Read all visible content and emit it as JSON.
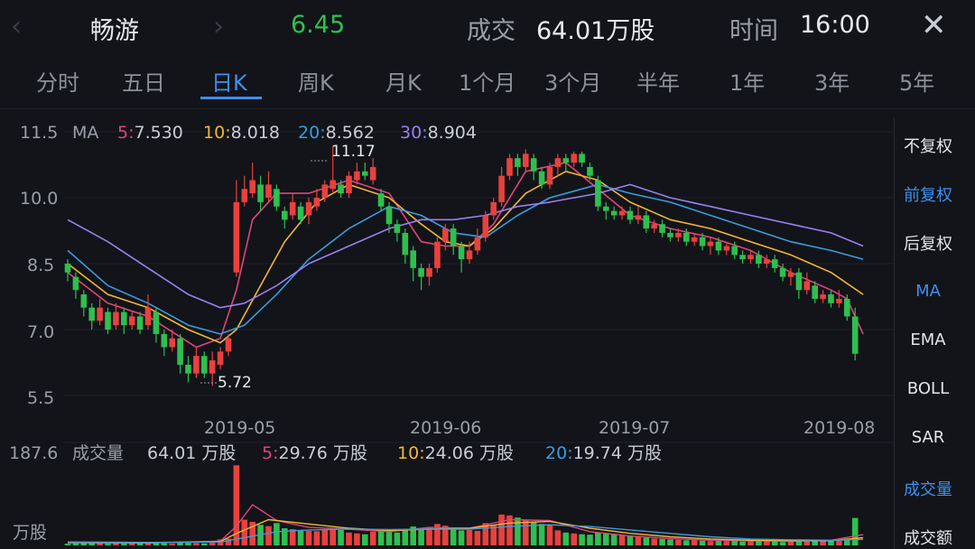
{
  "header": {
    "name": "畅游",
    "price": "6.45",
    "volume_label": "成交",
    "volume_value": "64.01万股",
    "time_label": "时间",
    "time_value": "16:00",
    "prev_icon": "chevron-left-icon",
    "next_icon": "chevron-right-icon",
    "close_icon": "close-icon"
  },
  "tabs": [
    "分时",
    "五日",
    "日K",
    "周K",
    "月K",
    "1个月",
    "3个月",
    "半年",
    "1年",
    "3年",
    "5年"
  ],
  "active_tab": "日K",
  "side_menu": [
    {
      "label": "不复权",
      "active": false
    },
    {
      "label": "前复权",
      "active": true
    },
    {
      "label": "后复权",
      "active": false
    },
    {
      "label": "MA",
      "active": true
    },
    {
      "label": "EMA",
      "active": false
    },
    {
      "label": "BOLL",
      "active": false
    },
    {
      "label": "SAR",
      "active": false
    },
    {
      "label": "成交量",
      "active": true
    },
    {
      "label": "成交额",
      "active": false
    }
  ],
  "colors": {
    "up": "#e8413e",
    "down": "#2fbf4f",
    "ma5": "#e0457b",
    "ma10": "#f2b632",
    "ma20": "#3b9be0",
    "ma30": "#9b7ef0",
    "accent": "#3d8ff0"
  },
  "chart_data": {
    "type": "candlestick",
    "ma_legend": {
      "label": "MA",
      "items": [
        {
          "key": "5",
          "value": "7.530"
        },
        {
          "key": "10",
          "value": "8.018"
        },
        {
          "key": "20",
          "value": "8.562"
        },
        {
          "key": "30",
          "value": "8.904"
        }
      ]
    },
    "y_ticks": [
      "11.5",
      "10.0",
      "8.5",
      "7.0",
      "5.5"
    ],
    "ylim": [
      5.5,
      11.5
    ],
    "x_ticks": [
      "2019-05",
      "2019-06",
      "2019-07",
      "2019-08"
    ],
    "x_tick_index": [
      18,
      46,
      72,
      100
    ],
    "annotations": [
      {
        "text": "11.17",
        "index": 33,
        "value": 11.17
      },
      {
        "text": "5.72",
        "index": 18,
        "value": 5.72
      }
    ],
    "candles": [
      [
        8.5,
        8.3,
        8.6,
        8.1
      ],
      [
        8.2,
        7.9,
        8.3,
        7.7
      ],
      [
        7.8,
        7.5,
        7.9,
        7.3
      ],
      [
        7.5,
        7.2,
        7.6,
        7.0
      ],
      [
        7.2,
        7.5,
        7.7,
        7.1
      ],
      [
        7.4,
        7.0,
        7.5,
        6.9
      ],
      [
        7.1,
        7.4,
        7.6,
        7.0
      ],
      [
        7.4,
        7.1,
        7.5,
        6.9
      ],
      [
        7.1,
        7.3,
        7.4,
        7.0
      ],
      [
        7.3,
        7.0,
        7.4,
        6.9
      ],
      [
        7.1,
        7.5,
        7.8,
        7.0
      ],
      [
        7.4,
        6.9,
        7.5,
        6.7
      ],
      [
        6.9,
        6.6,
        7.0,
        6.4
      ],
      [
        6.6,
        6.8,
        7.0,
        6.5
      ],
      [
        6.8,
        6.2,
        6.9,
        6.0
      ],
      [
        6.2,
        6.0,
        6.4,
        5.8
      ],
      [
        6.0,
        6.4,
        6.6,
        5.9
      ],
      [
        6.4,
        6.0,
        6.5,
        5.9
      ],
      [
        6.0,
        6.3,
        6.5,
        5.72
      ],
      [
        6.2,
        6.5,
        6.6,
        6.1
      ],
      [
        6.5,
        6.8,
        6.9,
        6.4
      ],
      [
        8.3,
        9.9,
        10.4,
        8.2
      ],
      [
        9.9,
        10.2,
        10.5,
        9.8
      ],
      [
        10.1,
        10.4,
        10.8,
        10.0
      ],
      [
        10.3,
        9.9,
        10.5,
        9.7
      ],
      [
        10.0,
        10.3,
        10.6,
        9.9
      ],
      [
        10.2,
        9.8,
        10.3,
        9.7
      ],
      [
        9.7,
        9.5,
        9.8,
        9.3
      ],
      [
        9.6,
        9.9,
        10.1,
        9.5
      ],
      [
        9.8,
        9.5,
        9.9,
        9.4
      ],
      [
        9.6,
        9.9,
        10.0,
        9.4
      ],
      [
        9.8,
        10.0,
        10.2,
        9.7
      ],
      [
        10.0,
        10.3,
        10.4,
        9.9
      ],
      [
        10.2,
        10.4,
        11.17,
        10.1
      ],
      [
        10.3,
        10.1,
        10.4,
        10.0
      ],
      [
        10.1,
        10.5,
        10.6,
        10.0
      ],
      [
        10.4,
        10.6,
        10.8,
        10.3
      ],
      [
        10.6,
        10.5,
        10.8,
        10.4
      ],
      [
        10.4,
        10.7,
        10.9,
        10.3
      ],
      [
        10.1,
        9.8,
        10.2,
        9.7
      ],
      [
        9.8,
        9.4,
        9.9,
        9.2
      ],
      [
        9.4,
        9.2,
        9.5,
        9.0
      ],
      [
        9.2,
        8.7,
        9.3,
        8.5
      ],
      [
        8.8,
        8.4,
        8.9,
        8.1
      ],
      [
        8.4,
        8.2,
        8.5,
        7.9
      ],
      [
        8.2,
        8.4,
        8.5,
        8.0
      ],
      [
        8.4,
        9.0,
        9.1,
        8.3
      ],
      [
        9.0,
        9.3,
        9.4,
        8.8
      ],
      [
        9.3,
        8.9,
        9.4,
        8.7
      ],
      [
        8.9,
        8.6,
        9.0,
        8.3
      ],
      [
        8.6,
        8.8,
        9.0,
        8.5
      ],
      [
        8.8,
        9.1,
        9.3,
        8.7
      ],
      [
        9.1,
        9.6,
        9.7,
        9.0
      ],
      [
        9.6,
        9.9,
        10.0,
        9.5
      ],
      [
        9.9,
        10.5,
        10.7,
        9.8
      ],
      [
        10.5,
        10.9,
        11.0,
        10.4
      ],
      [
        10.9,
        10.7,
        11.0,
        10.5
      ],
      [
        10.7,
        11.0,
        11.1,
        10.6
      ],
      [
        10.9,
        10.6,
        11.0,
        10.4
      ],
      [
        10.6,
        10.3,
        10.7,
        10.2
      ],
      [
        10.3,
        10.7,
        10.8,
        10.2
      ],
      [
        10.7,
        10.9,
        11.0,
        10.5
      ],
      [
        10.9,
        10.8,
        11.0,
        10.6
      ],
      [
        10.8,
        11.0,
        11.05,
        10.7
      ],
      [
        11.0,
        10.8,
        11.05,
        10.7
      ],
      [
        10.7,
        10.5,
        10.8,
        10.4
      ],
      [
        10.4,
        9.8,
        10.5,
        9.7
      ],
      [
        9.8,
        9.7,
        9.9,
        9.5
      ],
      [
        9.7,
        9.6,
        9.8,
        9.5
      ],
      [
        9.6,
        9.7,
        9.8,
        9.5
      ],
      [
        9.7,
        9.5,
        9.8,
        9.4
      ],
      [
        9.5,
        9.6,
        9.8,
        9.4
      ],
      [
        9.6,
        9.3,
        9.7,
        9.2
      ],
      [
        9.3,
        9.4,
        9.5,
        9.2
      ],
      [
        9.4,
        9.2,
        9.5,
        9.1
      ],
      [
        9.2,
        9.1,
        9.3,
        9.0
      ],
      [
        9.1,
        9.2,
        9.3,
        9.0
      ],
      [
        9.2,
        9.0,
        9.3,
        8.9
      ],
      [
        9.0,
        9.1,
        9.2,
        8.9
      ],
      [
        9.1,
        8.9,
        9.2,
        8.8
      ],
      [
        8.9,
        9.0,
        9.1,
        8.7
      ],
      [
        9.0,
        8.8,
        9.1,
        8.7
      ],
      [
        8.8,
        8.9,
        9.0,
        8.7
      ],
      [
        8.9,
        8.7,
        9.0,
        8.6
      ],
      [
        8.7,
        8.6,
        8.8,
        8.5
      ],
      [
        8.6,
        8.7,
        8.8,
        8.5
      ],
      [
        8.7,
        8.5,
        8.8,
        8.4
      ],
      [
        8.5,
        8.6,
        8.7,
        8.4
      ],
      [
        8.6,
        8.4,
        8.7,
        8.3
      ],
      [
        8.4,
        8.2,
        8.5,
        8.1
      ],
      [
        8.2,
        8.3,
        8.4,
        8.0
      ],
      [
        8.3,
        7.9,
        8.4,
        7.7
      ],
      [
        7.9,
        8.1,
        8.3,
        7.8
      ],
      [
        8.0,
        7.7,
        8.1,
        7.6
      ],
      [
        7.7,
        7.8,
        7.9,
        7.6
      ],
      [
        7.8,
        7.6,
        7.9,
        7.5
      ],
      [
        7.6,
        7.7,
        7.9,
        7.5
      ],
      [
        7.7,
        7.3,
        7.8,
        7.2
      ],
      [
        7.3,
        6.45,
        7.5,
        6.3
      ]
    ],
    "ma": {
      "ma5": [
        [
          0,
          8.3
        ],
        [
          5,
          7.6
        ],
        [
          10,
          7.3
        ],
        [
          16,
          6.6
        ],
        [
          19,
          6.8
        ],
        [
          21,
          7.9
        ],
        [
          23,
          9.5
        ],
        [
          26,
          10.1
        ],
        [
          30,
          10.1
        ],
        [
          35,
          10.4
        ],
        [
          40,
          10.1
        ],
        [
          44,
          9.0
        ],
        [
          47,
          8.9
        ],
        [
          50,
          8.9
        ],
        [
          53,
          9.4
        ],
        [
          57,
          10.6
        ],
        [
          62,
          10.8
        ],
        [
          66,
          10.2
        ],
        [
          70,
          9.6
        ],
        [
          75,
          9.3
        ],
        [
          80,
          9.1
        ],
        [
          85,
          8.8
        ],
        [
          90,
          8.3
        ],
        [
          95,
          7.9
        ],
        [
          97,
          7.7
        ],
        [
          99,
          6.9
        ]
      ],
      "ma10": [
        [
          0,
          8.5
        ],
        [
          5,
          7.8
        ],
        [
          10,
          7.5
        ],
        [
          15,
          7.0
        ],
        [
          19,
          6.7
        ],
        [
          21,
          7.0
        ],
        [
          24,
          8.0
        ],
        [
          27,
          9.0
        ],
        [
          31,
          9.9
        ],
        [
          35,
          10.3
        ],
        [
          40,
          10.0
        ],
        [
          44,
          9.4
        ],
        [
          47,
          9.0
        ],
        [
          50,
          8.9
        ],
        [
          53,
          9.3
        ],
        [
          57,
          10.1
        ],
        [
          62,
          10.6
        ],
        [
          66,
          10.4
        ],
        [
          70,
          9.9
        ],
        [
          75,
          9.5
        ],
        [
          80,
          9.3
        ],
        [
          85,
          9.0
        ],
        [
          90,
          8.7
        ],
        [
          95,
          8.3
        ],
        [
          99,
          7.8
        ]
      ],
      "ma20": [
        [
          0,
          8.8
        ],
        [
          5,
          8.0
        ],
        [
          10,
          7.6
        ],
        [
          15,
          7.1
        ],
        [
          19,
          6.9
        ],
        [
          22,
          7.1
        ],
        [
          26,
          7.8
        ],
        [
          30,
          8.6
        ],
        [
          35,
          9.3
        ],
        [
          40,
          9.8
        ],
        [
          44,
          9.6
        ],
        [
          48,
          9.2
        ],
        [
          52,
          9.1
        ],
        [
          56,
          9.6
        ],
        [
          60,
          10.0
        ],
        [
          66,
          10.3
        ],
        [
          70,
          10.1
        ],
        [
          75,
          9.9
        ],
        [
          80,
          9.6
        ],
        [
          85,
          9.3
        ],
        [
          90,
          9.0
        ],
        [
          95,
          8.8
        ],
        [
          99,
          8.6
        ]
      ],
      "ma30": [
        [
          0,
          9.5
        ],
        [
          5,
          9.0
        ],
        [
          10,
          8.4
        ],
        [
          15,
          7.8
        ],
        [
          19,
          7.5
        ],
        [
          22,
          7.6
        ],
        [
          26,
          8.0
        ],
        [
          30,
          8.5
        ],
        [
          35,
          8.9
        ],
        [
          40,
          9.3
        ],
        [
          44,
          9.5
        ],
        [
          48,
          9.5
        ],
        [
          52,
          9.6
        ],
        [
          56,
          9.8
        ],
        [
          60,
          9.9
        ],
        [
          66,
          10.1
        ],
        [
          70,
          10.3
        ],
        [
          75,
          10.0
        ],
        [
          80,
          9.8
        ],
        [
          85,
          9.6
        ],
        [
          90,
          9.4
        ],
        [
          95,
          9.2
        ],
        [
          99,
          8.9
        ]
      ]
    },
    "volume": {
      "y_tick": "187.6",
      "unit": "万股",
      "legend": {
        "label": "成交量",
        "total": "64.01 万股",
        "items": [
          {
            "key": "5",
            "value": "29.76 万股"
          },
          {
            "key": "10",
            "value": "24.06 万股"
          },
          {
            "key": "20",
            "value": "19.74 万股"
          }
        ]
      },
      "max": 187.6,
      "values": [
        4,
        5,
        6,
        5,
        7,
        4,
        5,
        4,
        6,
        5,
        8,
        6,
        5,
        4,
        7,
        8,
        6,
        5,
        9,
        14,
        16,
        187,
        60,
        55,
        48,
        45,
        52,
        40,
        38,
        35,
        34,
        33,
        38,
        40,
        36,
        30,
        28,
        26,
        32,
        35,
        34,
        30,
        38,
        44,
        40,
        42,
        50,
        46,
        38,
        35,
        36,
        34,
        52,
        48,
        72,
        70,
        65,
        60,
        55,
        50,
        48,
        35,
        30,
        28,
        26,
        25,
        30,
        28,
        26,
        24,
        22,
        20,
        18,
        16,
        15,
        14,
        13,
        12,
        14,
        11,
        10,
        12,
        10,
        11,
        9,
        10,
        12,
        11,
        10,
        8,
        12,
        11,
        9,
        10,
        11,
        12,
        13,
        16,
        64
      ],
      "ma5": [
        [
          0,
          6
        ],
        [
          10,
          6
        ],
        [
          19,
          10
        ],
        [
          21,
          45
        ],
        [
          23,
          95
        ],
        [
          26,
          58
        ],
        [
          30,
          42
        ],
        [
          35,
          38
        ],
        [
          40,
          32
        ],
        [
          45,
          42
        ],
        [
          50,
          40
        ],
        [
          55,
          60
        ],
        [
          60,
          58
        ],
        [
          65,
          32
        ],
        [
          70,
          22
        ],
        [
          75,
          16
        ],
        [
          80,
          12
        ],
        [
          85,
          11
        ],
        [
          90,
          10
        ],
        [
          95,
          12
        ],
        [
          99,
          25
        ]
      ],
      "ma10": [
        [
          0,
          7
        ],
        [
          10,
          6
        ],
        [
          19,
          9
        ],
        [
          21,
          28
        ],
        [
          25,
          60
        ],
        [
          30,
          50
        ],
        [
          35,
          40
        ],
        [
          40,
          35
        ],
        [
          45,
          38
        ],
        [
          50,
          40
        ],
        [
          55,
          52
        ],
        [
          60,
          56
        ],
        [
          65,
          40
        ],
        [
          70,
          28
        ],
        [
          75,
          20
        ],
        [
          80,
          15
        ],
        [
          85,
          12
        ],
        [
          90,
          11
        ],
        [
          95,
          11
        ],
        [
          99,
          18
        ]
      ],
      "ma20": [
        [
          0,
          8
        ],
        [
          10,
          7
        ],
        [
          19,
          8
        ],
        [
          22,
          18
        ],
        [
          26,
          32
        ],
        [
          30,
          36
        ],
        [
          35,
          38
        ],
        [
          40,
          37
        ],
        [
          45,
          38
        ],
        [
          50,
          38
        ],
        [
          55,
          44
        ],
        [
          60,
          48
        ],
        [
          65,
          44
        ],
        [
          70,
          36
        ],
        [
          75,
          28
        ],
        [
          80,
          20
        ],
        [
          85,
          15
        ],
        [
          90,
          13
        ],
        [
          95,
          12
        ],
        [
          99,
          14
        ]
      ]
    }
  }
}
